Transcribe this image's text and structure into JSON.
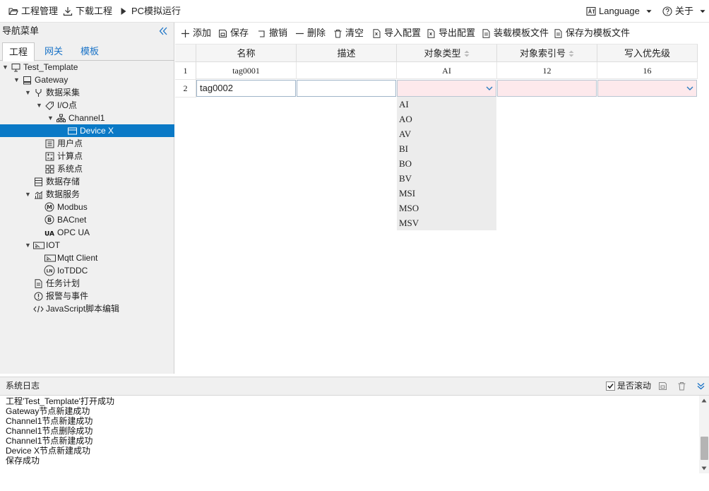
{
  "topbar": {
    "project_mgmt": "工程管理",
    "download_project": "下载工程",
    "pc_sim": "PC模拟运行",
    "language": "Language",
    "about": "关于"
  },
  "nav": {
    "title": "导航菜单",
    "tabs": [
      "工程",
      "网关",
      "模板"
    ]
  },
  "tree": [
    {
      "label": "Test_Template",
      "icon": "monitor-icon"
    },
    {
      "label": "Gateway",
      "icon": "gateway-icon"
    },
    {
      "label": "数据采集",
      "icon": "fork-icon"
    },
    {
      "label": "I/O点",
      "icon": "tag-icon"
    },
    {
      "label": "Channel1",
      "icon": "network-icon"
    },
    {
      "label": "Device X",
      "icon": "device-icon"
    },
    {
      "label": "用户点",
      "icon": "list-icon"
    },
    {
      "label": "计算点",
      "icon": "calculator-icon"
    },
    {
      "label": "系统点",
      "icon": "grid-icon"
    },
    {
      "label": "数据存储",
      "icon": "database-icon"
    },
    {
      "label": "数据服务",
      "icon": "chart-icon"
    },
    {
      "label": "Modbus",
      "icon": "modbus-icon"
    },
    {
      "label": "BACnet",
      "icon": "bacnet-icon"
    },
    {
      "label": "OPC UA",
      "icon": "opcua-icon"
    },
    {
      "label": "IOT",
      "icon": "iot-icon"
    },
    {
      "label": "Mqtt Client",
      "icon": "mqtt-icon"
    },
    {
      "label": "IoTDDC",
      "icon": "iotddc-icon"
    },
    {
      "label": "任务计划",
      "icon": "document-icon"
    },
    {
      "label": "报警与事件",
      "icon": "alarm-icon"
    },
    {
      "label": "JavaScript脚本编辑",
      "icon": "code-icon"
    }
  ],
  "toolbar": {
    "add": "添加",
    "save": "保存",
    "undo": "撤销",
    "delete": "删除",
    "clear": "清空",
    "import_config": "导入配置",
    "export_config": "导出配置",
    "load_template": "装载模板文件",
    "save_template": "保存为模板文件"
  },
  "table": {
    "headers": [
      "名称",
      "描述",
      "对象类型",
      "对象索引号",
      "写入优先级"
    ],
    "rows": [
      {
        "num": "1",
        "name": "tag0001",
        "desc": "",
        "type": "AI",
        "index": "12",
        "priority": "16"
      },
      {
        "num": "2",
        "name": "tag0002",
        "desc": "",
        "type": "",
        "index": "",
        "priority": ""
      }
    ]
  },
  "dropdown_options": [
    "AI",
    "AO",
    "AV",
    "BI",
    "BO",
    "BV",
    "MSI",
    "MSO",
    "MSV"
  ],
  "log": {
    "title": "系统日志",
    "autoscroll_label": "是否滚动",
    "autoscroll_checked": true,
    "lines": [
      "工程'Test_Template'打开成功",
      "Gateway节点新建成功",
      "Channel1节点新建成功",
      "Channel1节点删除成功",
      "Channel1节点新建成功",
      "Device X节点新建成功",
      "保存成功"
    ]
  },
  "colors": {
    "accent": "#0a79c6",
    "tab_link": "#1a73c7",
    "invalid_cell": "#fde9ec"
  }
}
